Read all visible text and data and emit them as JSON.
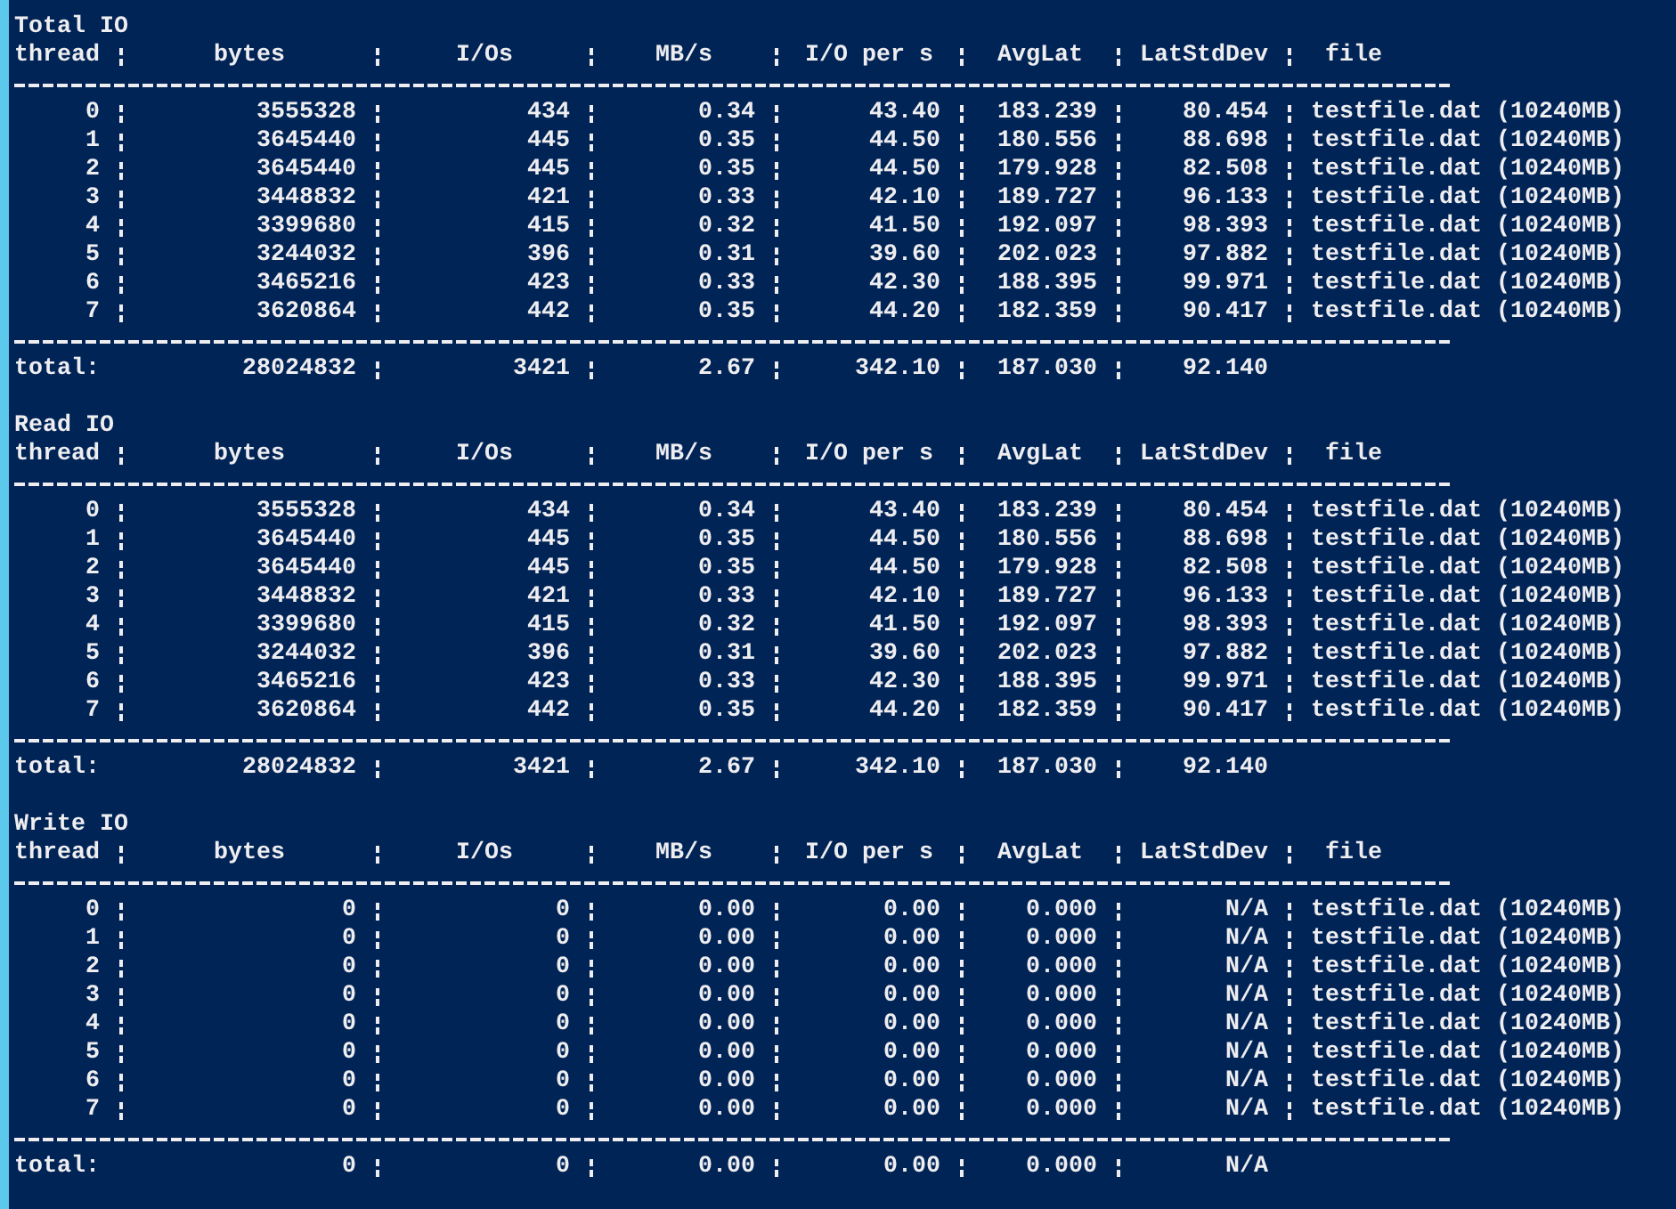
{
  "sections": [
    {
      "title": "Total IO",
      "columns": [
        "thread",
        "bytes",
        "I/Os",
        "MB/s",
        "I/O per s",
        "AvgLat",
        "LatStdDev",
        "file"
      ],
      "rows": [
        {
          "cells": [
            "0",
            "3555328",
            "434",
            "0.34",
            "43.40",
            "183.239",
            "80.454",
            "testfile.dat (10240MB)"
          ]
        },
        {
          "cells": [
            "1",
            "3645440",
            "445",
            "0.35",
            "44.50",
            "180.556",
            "88.698",
            "testfile.dat (10240MB)"
          ]
        },
        {
          "cells": [
            "2",
            "3645440",
            "445",
            "0.35",
            "44.50",
            "179.928",
            "82.508",
            "testfile.dat (10240MB)"
          ]
        },
        {
          "cells": [
            "3",
            "3448832",
            "421",
            "0.33",
            "42.10",
            "189.727",
            "96.133",
            "testfile.dat (10240MB)"
          ]
        },
        {
          "cells": [
            "4",
            "3399680",
            "415",
            "0.32",
            "41.50",
            "192.097",
            "98.393",
            "testfile.dat (10240MB)"
          ]
        },
        {
          "cells": [
            "5",
            "3244032",
            "396",
            "0.31",
            "39.60",
            "202.023",
            "97.882",
            "testfile.dat (10240MB)"
          ]
        },
        {
          "cells": [
            "6",
            "3465216",
            "423",
            "0.33",
            "42.30",
            "188.395",
            "99.971",
            "testfile.dat (10240MB)"
          ]
        },
        {
          "cells": [
            "7",
            "3620864",
            "442",
            "0.35",
            "44.20",
            "182.359",
            "90.417",
            "testfile.dat (10240MB)"
          ]
        }
      ],
      "total": {
        "label": "total:",
        "cells": [
          "28024832",
          "3421",
          "2.67",
          "342.10",
          "187.030",
          "92.140"
        ]
      }
    },
    {
      "title": "Read IO",
      "columns": [
        "thread",
        "bytes",
        "I/Os",
        "MB/s",
        "I/O per s",
        "AvgLat",
        "LatStdDev",
        "file"
      ],
      "rows": [
        {
          "cells": [
            "0",
            "3555328",
            "434",
            "0.34",
            "43.40",
            "183.239",
            "80.454",
            "testfile.dat (10240MB)"
          ]
        },
        {
          "cells": [
            "1",
            "3645440",
            "445",
            "0.35",
            "44.50",
            "180.556",
            "88.698",
            "testfile.dat (10240MB)"
          ]
        },
        {
          "cells": [
            "2",
            "3645440",
            "445",
            "0.35",
            "44.50",
            "179.928",
            "82.508",
            "testfile.dat (10240MB)"
          ]
        },
        {
          "cells": [
            "3",
            "3448832",
            "421",
            "0.33",
            "42.10",
            "189.727",
            "96.133",
            "testfile.dat (10240MB)"
          ]
        },
        {
          "cells": [
            "4",
            "3399680",
            "415",
            "0.32",
            "41.50",
            "192.097",
            "98.393",
            "testfile.dat (10240MB)"
          ]
        },
        {
          "cells": [
            "5",
            "3244032",
            "396",
            "0.31",
            "39.60",
            "202.023",
            "97.882",
            "testfile.dat (10240MB)"
          ]
        },
        {
          "cells": [
            "6",
            "3465216",
            "423",
            "0.33",
            "42.30",
            "188.395",
            "99.971",
            "testfile.dat (10240MB)"
          ]
        },
        {
          "cells": [
            "7",
            "3620864",
            "442",
            "0.35",
            "44.20",
            "182.359",
            "90.417",
            "testfile.dat (10240MB)"
          ]
        }
      ],
      "total": {
        "label": "total:",
        "cells": [
          "28024832",
          "3421",
          "2.67",
          "342.10",
          "187.030",
          "92.140"
        ]
      }
    },
    {
      "title": "Write IO",
      "columns": [
        "thread",
        "bytes",
        "I/Os",
        "MB/s",
        "I/O per s",
        "AvgLat",
        "LatStdDev",
        "file"
      ],
      "rows": [
        {
          "cells": [
            "0",
            "0",
            "0",
            "0.00",
            "0.00",
            "0.000",
            "N/A",
            "testfile.dat (10240MB)"
          ]
        },
        {
          "cells": [
            "1",
            "0",
            "0",
            "0.00",
            "0.00",
            "0.000",
            "N/A",
            "testfile.dat (10240MB)"
          ]
        },
        {
          "cells": [
            "2",
            "0",
            "0",
            "0.00",
            "0.00",
            "0.000",
            "N/A",
            "testfile.dat (10240MB)"
          ]
        },
        {
          "cells": [
            "3",
            "0",
            "0",
            "0.00",
            "0.00",
            "0.000",
            "N/A",
            "testfile.dat (10240MB)"
          ]
        },
        {
          "cells": [
            "4",
            "0",
            "0",
            "0.00",
            "0.00",
            "0.000",
            "N/A",
            "testfile.dat (10240MB)"
          ]
        },
        {
          "cells": [
            "5",
            "0",
            "0",
            "0.00",
            "0.00",
            "0.000",
            "N/A",
            "testfile.dat (10240MB)"
          ]
        },
        {
          "cells": [
            "6",
            "0",
            "0",
            "0.00",
            "0.00",
            "0.000",
            "N/A",
            "testfile.dat (10240MB)"
          ]
        },
        {
          "cells": [
            "7",
            "0",
            "0",
            "0.00",
            "0.00",
            "0.000",
            "N/A",
            "testfile.dat (10240MB)"
          ]
        }
      ],
      "total": {
        "label": "total:",
        "cells": [
          "0",
          "0",
          "0.00",
          "0.00",
          "0.000",
          "N/A"
        ]
      }
    }
  ]
}
